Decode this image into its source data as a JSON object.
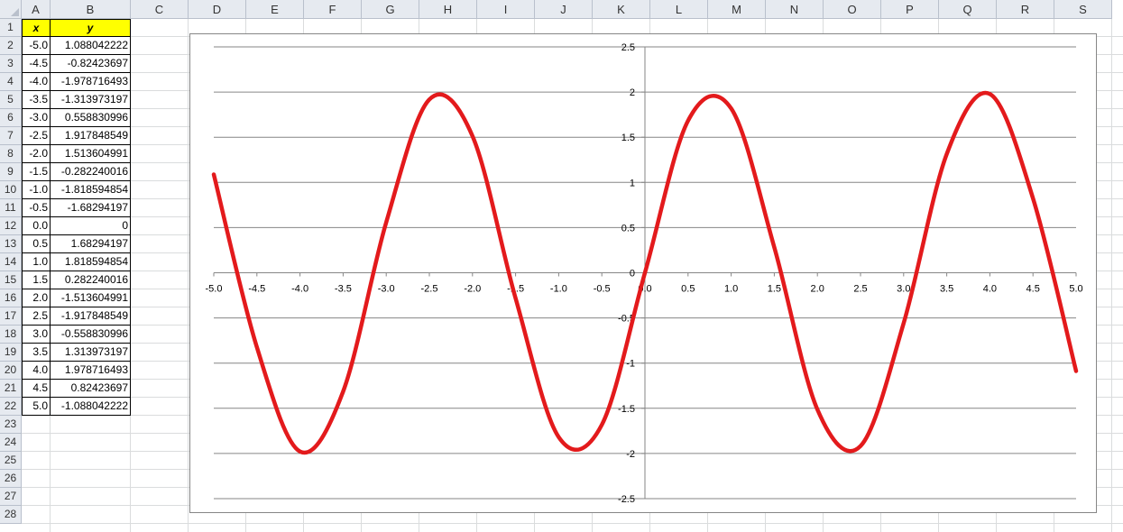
{
  "columns": [
    "A",
    "B",
    "C",
    "D",
    "E",
    "F",
    "G",
    "H",
    "I",
    "J",
    "K",
    "L",
    "M",
    "N",
    "O",
    "P",
    "Q",
    "R",
    "S"
  ],
  "rows": [
    "1",
    "2",
    "3",
    "4",
    "5",
    "6",
    "7",
    "8",
    "9",
    "10",
    "11",
    "12",
    "13",
    "14",
    "15",
    "16",
    "17",
    "18",
    "19",
    "20",
    "21",
    "22",
    "23",
    "24",
    "25",
    "26",
    "27",
    "28"
  ],
  "table": {
    "header_x": "x",
    "header_y": "y",
    "rows": [
      {
        "x": "-5.0",
        "y": "1.088042222"
      },
      {
        "x": "-4.5",
        "y": "-0.82423697"
      },
      {
        "x": "-4.0",
        "y": "-1.978716493"
      },
      {
        "x": "-3.5",
        "y": "-1.313973197"
      },
      {
        "x": "-3.0",
        "y": "0.558830996"
      },
      {
        "x": "-2.5",
        "y": "1.917848549"
      },
      {
        "x": "-2.0",
        "y": "1.513604991"
      },
      {
        "x": "-1.5",
        "y": "-0.282240016"
      },
      {
        "x": "-1.0",
        "y": "-1.818594854"
      },
      {
        "x": "-0.5",
        "y": "-1.68294197"
      },
      {
        "x": "0.0",
        "y": "0"
      },
      {
        "x": "0.5",
        "y": "1.68294197"
      },
      {
        "x": "1.0",
        "y": "1.818594854"
      },
      {
        "x": "1.5",
        "y": "0.282240016"
      },
      {
        "x": "2.0",
        "y": "-1.513604991"
      },
      {
        "x": "2.5",
        "y": "-1.917848549"
      },
      {
        "x": "3.0",
        "y": "-0.558830996"
      },
      {
        "x": "3.5",
        "y": "1.313973197"
      },
      {
        "x": "4.0",
        "y": "1.978716493"
      },
      {
        "x": "4.5",
        "y": "0.82423697"
      },
      {
        "x": "5.0",
        "y": "-1.088042222"
      }
    ]
  },
  "colors": {
    "header_fill": "#ffff00",
    "series_line": "#e31a1c",
    "gridline": "#868686"
  },
  "chart_data": {
    "type": "line",
    "smooth": true,
    "x": [
      -5.0,
      -4.5,
      -4.0,
      -3.5,
      -3.0,
      -2.5,
      -2.0,
      -1.5,
      -1.0,
      -0.5,
      0.0,
      0.5,
      1.0,
      1.5,
      2.0,
      2.5,
      3.0,
      3.5,
      4.0,
      4.5,
      5.0
    ],
    "series": [
      {
        "values": [
          1.088042222,
          -0.82423697,
          -1.978716493,
          -1.313973197,
          0.558830996,
          1.917848549,
          1.513604991,
          -0.282240016,
          -1.818594854,
          -1.68294197,
          0,
          1.68294197,
          1.818594854,
          0.282240016,
          -1.513604991,
          -1.917848549,
          -0.558830996,
          1.313973197,
          1.978716493,
          0.82423697,
          -1.088042222
        ]
      }
    ],
    "xlim": [
      -5.0,
      5.0
    ],
    "ylim": [
      -2.5,
      2.5
    ],
    "x_tick_labels": [
      "-5.0",
      "-4.5",
      "-4.0",
      "-3.5",
      "-3.0",
      "-2.5",
      "-2.0",
      "-1.5",
      "-1.0",
      "-0.5",
      "0.0",
      "0.5",
      "1.0",
      "1.5",
      "2.0",
      "2.5",
      "3.0",
      "3.5",
      "4.0",
      "4.5",
      "5.0"
    ],
    "y_tick_labels": [
      "2.5",
      "2",
      "1.5",
      "1",
      "0.5",
      "0",
      "-0.5",
      "-1",
      "-1.5",
      "-2",
      "-2.5"
    ],
    "y_ticks": [
      2.5,
      2,
      1.5,
      1,
      0.5,
      0,
      -0.5,
      -1,
      -1.5,
      -2,
      -2.5
    ],
    "grid": true,
    "legend": false
  }
}
